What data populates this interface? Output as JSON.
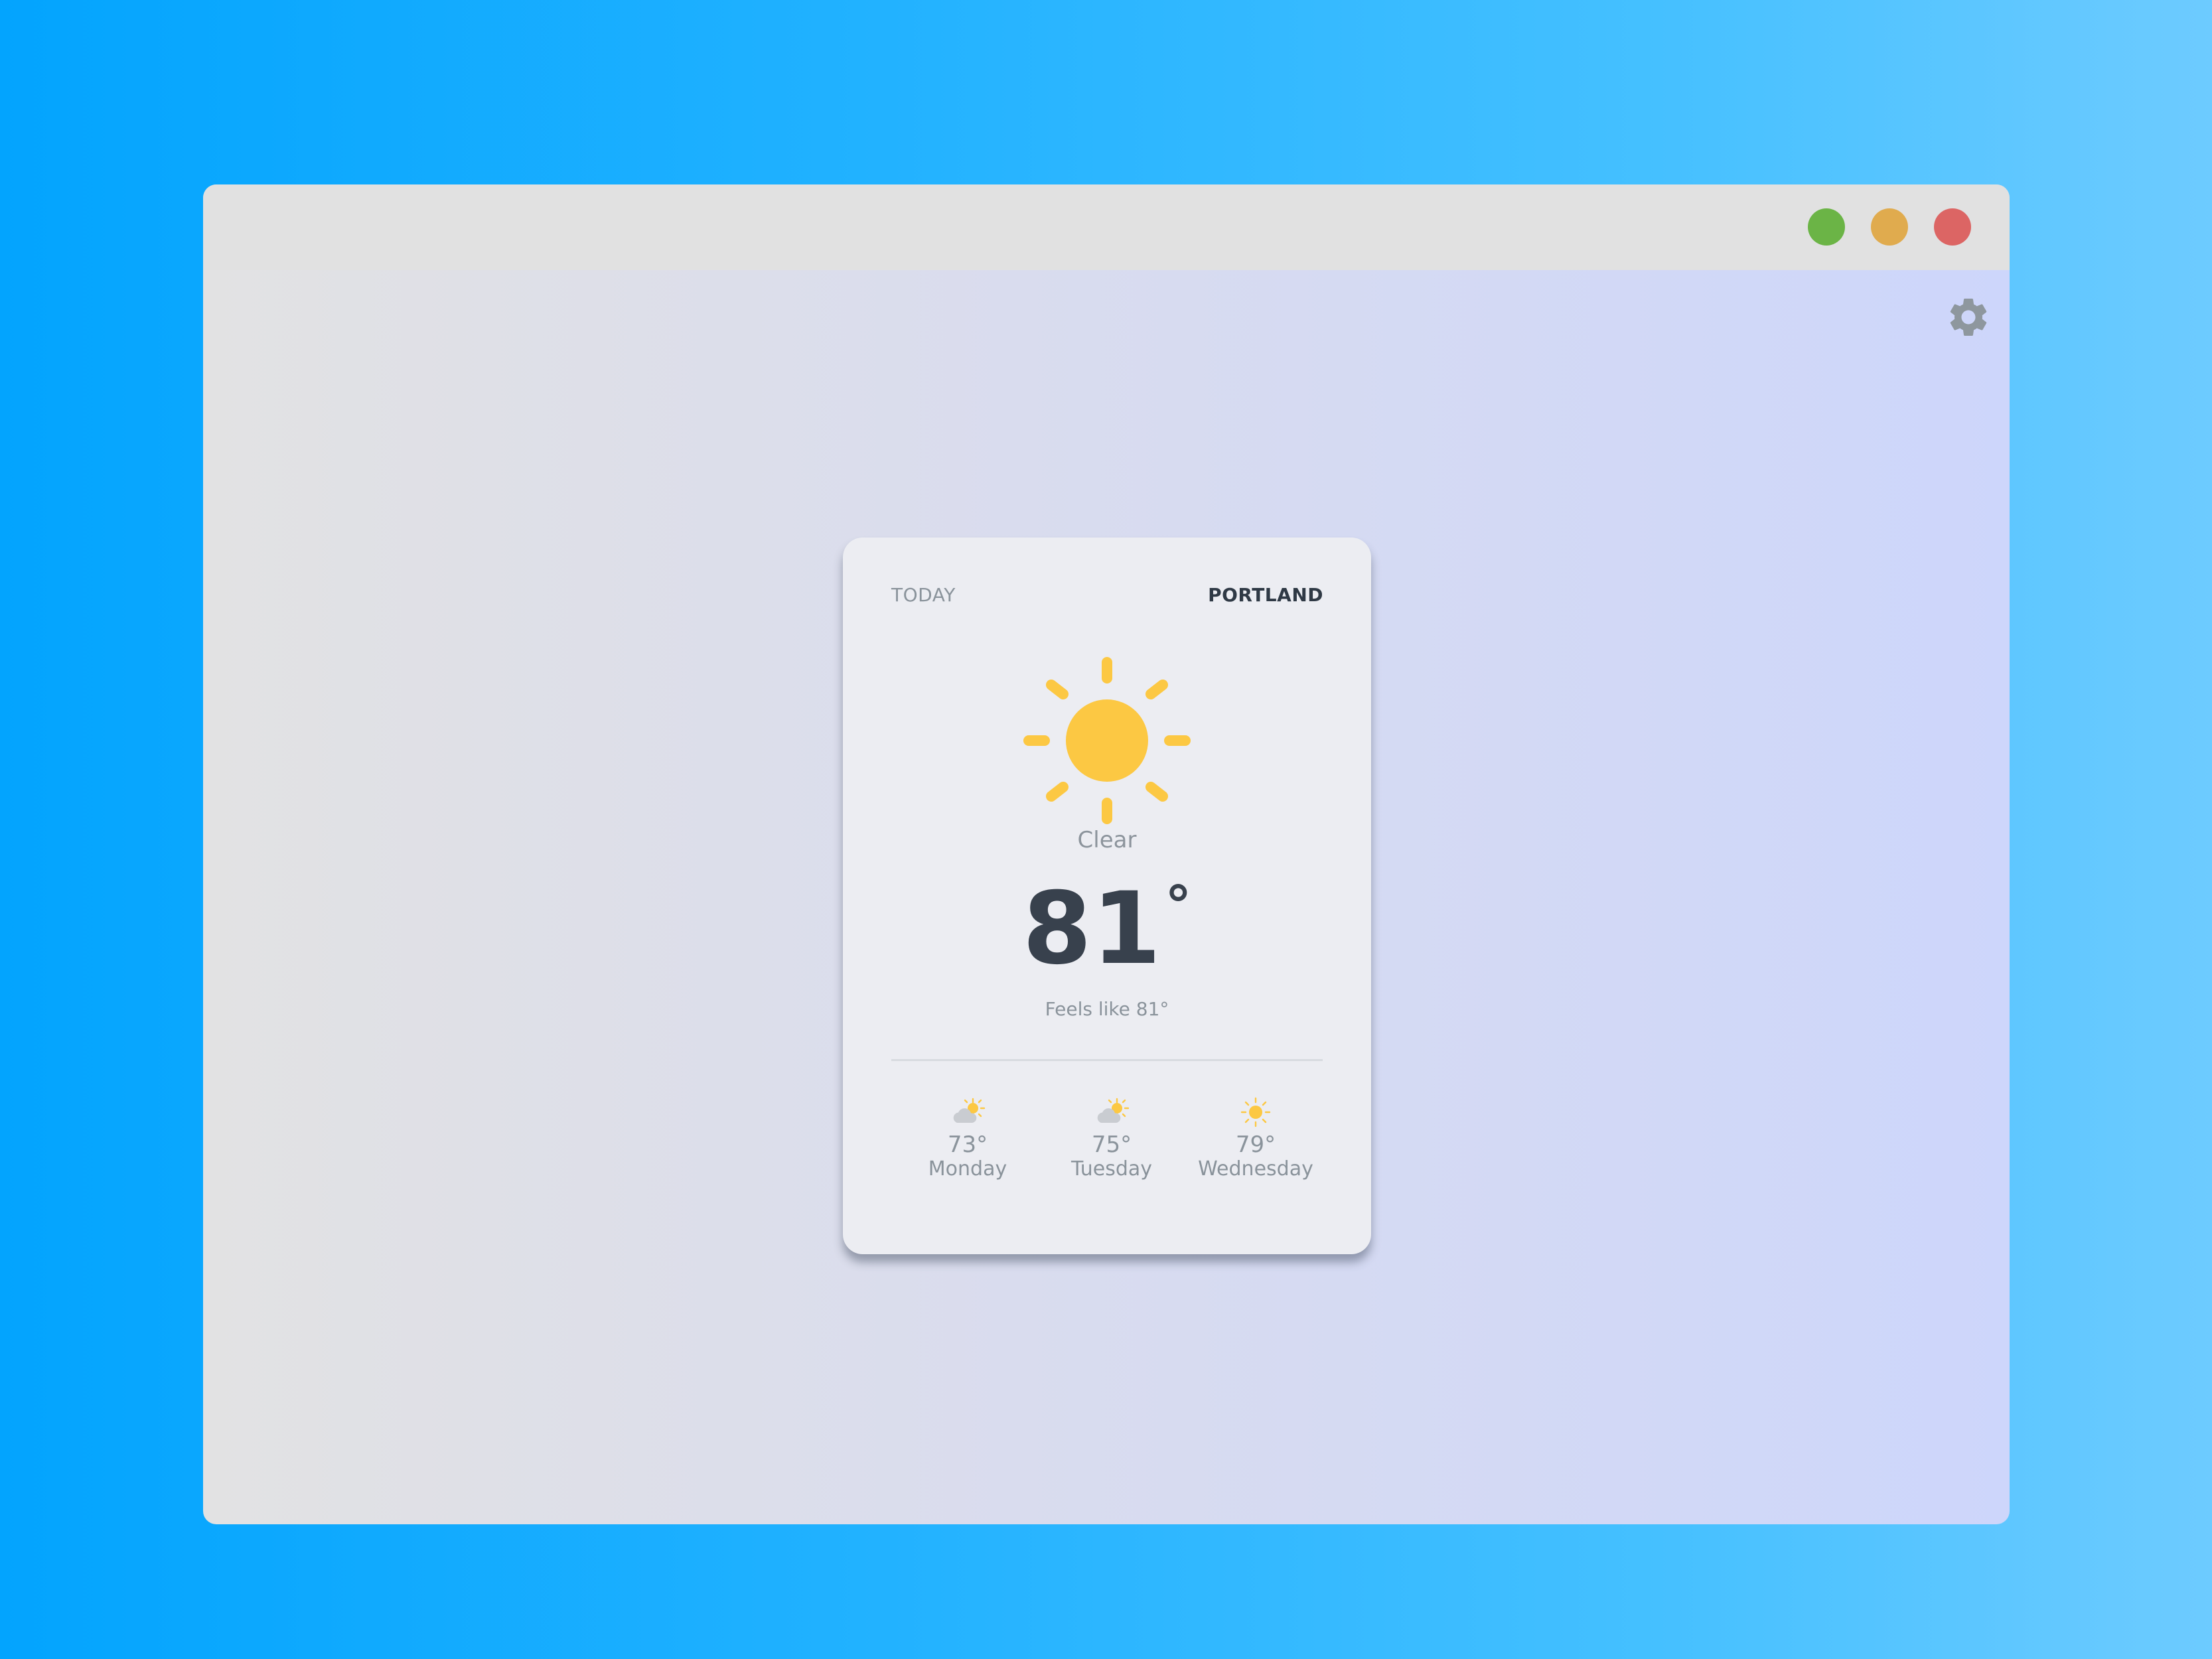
{
  "window": {
    "controls": [
      "green",
      "yellow",
      "red"
    ]
  },
  "colors": {
    "accent_sun": "#fcc843",
    "cloud": "#c9ccd1",
    "background_start": "#03a4fe",
    "background_end": "#6dcbff",
    "card": "#ecedf2",
    "text_dark": "#38414d",
    "text_muted": "#8a939b"
  },
  "settings": {
    "icon": "gear-icon"
  },
  "card": {
    "today_label": "TODAY",
    "city": "PORTLAND",
    "condition_icon": "sun-icon",
    "condition": "Clear",
    "temperature": "81",
    "degree_symbol": "°",
    "feels_like": "Feels like 81°"
  },
  "forecast": [
    {
      "icon": "partly-cloudy-icon",
      "temp": "73°",
      "day": "Monday"
    },
    {
      "icon": "partly-cloudy-icon",
      "temp": "75°",
      "day": "Tuesday"
    },
    {
      "icon": "sun-icon",
      "temp": "79°",
      "day": "Wednesday"
    }
  ]
}
